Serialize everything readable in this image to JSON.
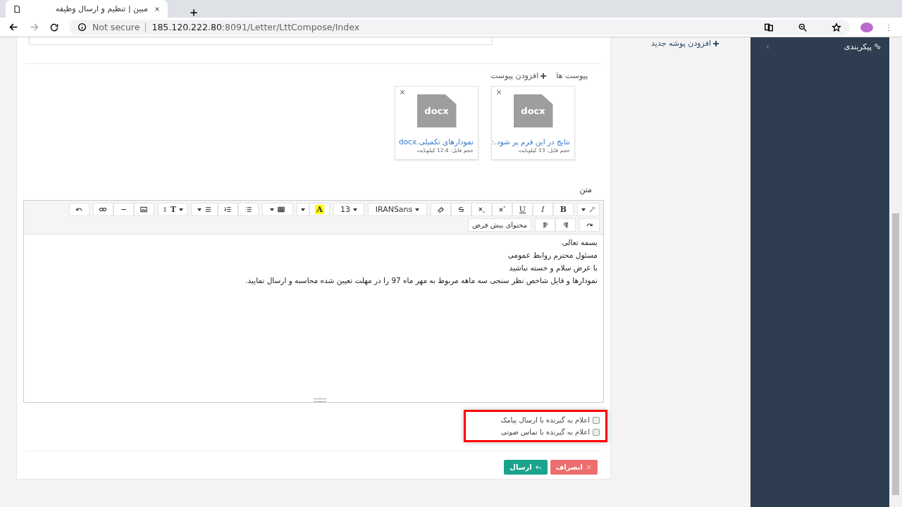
{
  "browser": {
    "tab_title": "مبین | تنظیم و ارسال وظیفه",
    "security": "Not secure",
    "url_host": "185.120.222.80",
    "url_path": ":8091/Letter/LttCompose/Index"
  },
  "sidebar": {
    "items": [
      {
        "label": "پیکربندی",
        "expanded": false
      }
    ]
  },
  "folder_link": "افزودن پوشه جدید",
  "attachments": {
    "title": "پیوست ها",
    "add_label": "افزودن پیوست",
    "files": [
      {
        "thumb": "docx",
        "name": "نتایج در این فرم پر شود.:",
        "size": "حجم فایل: 13 کیلوبایت"
      },
      {
        "thumb": "docx",
        "name": "نمودارهای تکمیلی.docx",
        "size": "حجم فایل: 12.4 کیلوبایت"
      }
    ]
  },
  "editor": {
    "label": "متن",
    "bold": "B",
    "italic": "I",
    "underline": "U",
    "font_name": "IRANSans",
    "font_size": "13",
    "color_letter": "A",
    "text_size_letter": "T",
    "default_content": "محتوای پیش فرض",
    "lines": [
      "بسمه تعالی",
      "مسئول محترم روابط عمومی",
      "با عرض سلام و خسته نباشید",
      "نمودارها و فایل شاخص نظر سنجی سه ماهه مربوط به مهر ماه 97 را در مهلت تعیین شده محاسبه و ارسال نمایید."
    ]
  },
  "notifications": [
    {
      "label": "اعلام به گیرنده با ارسال پیامک",
      "checked": false
    },
    {
      "label": "اعلام به گیرنده با تماس صوتی",
      "checked": false
    }
  ],
  "buttons": [
    {
      "kind": "cancel",
      "label": "انصراف"
    },
    {
      "kind": "send",
      "label": "ارسال"
    }
  ]
}
